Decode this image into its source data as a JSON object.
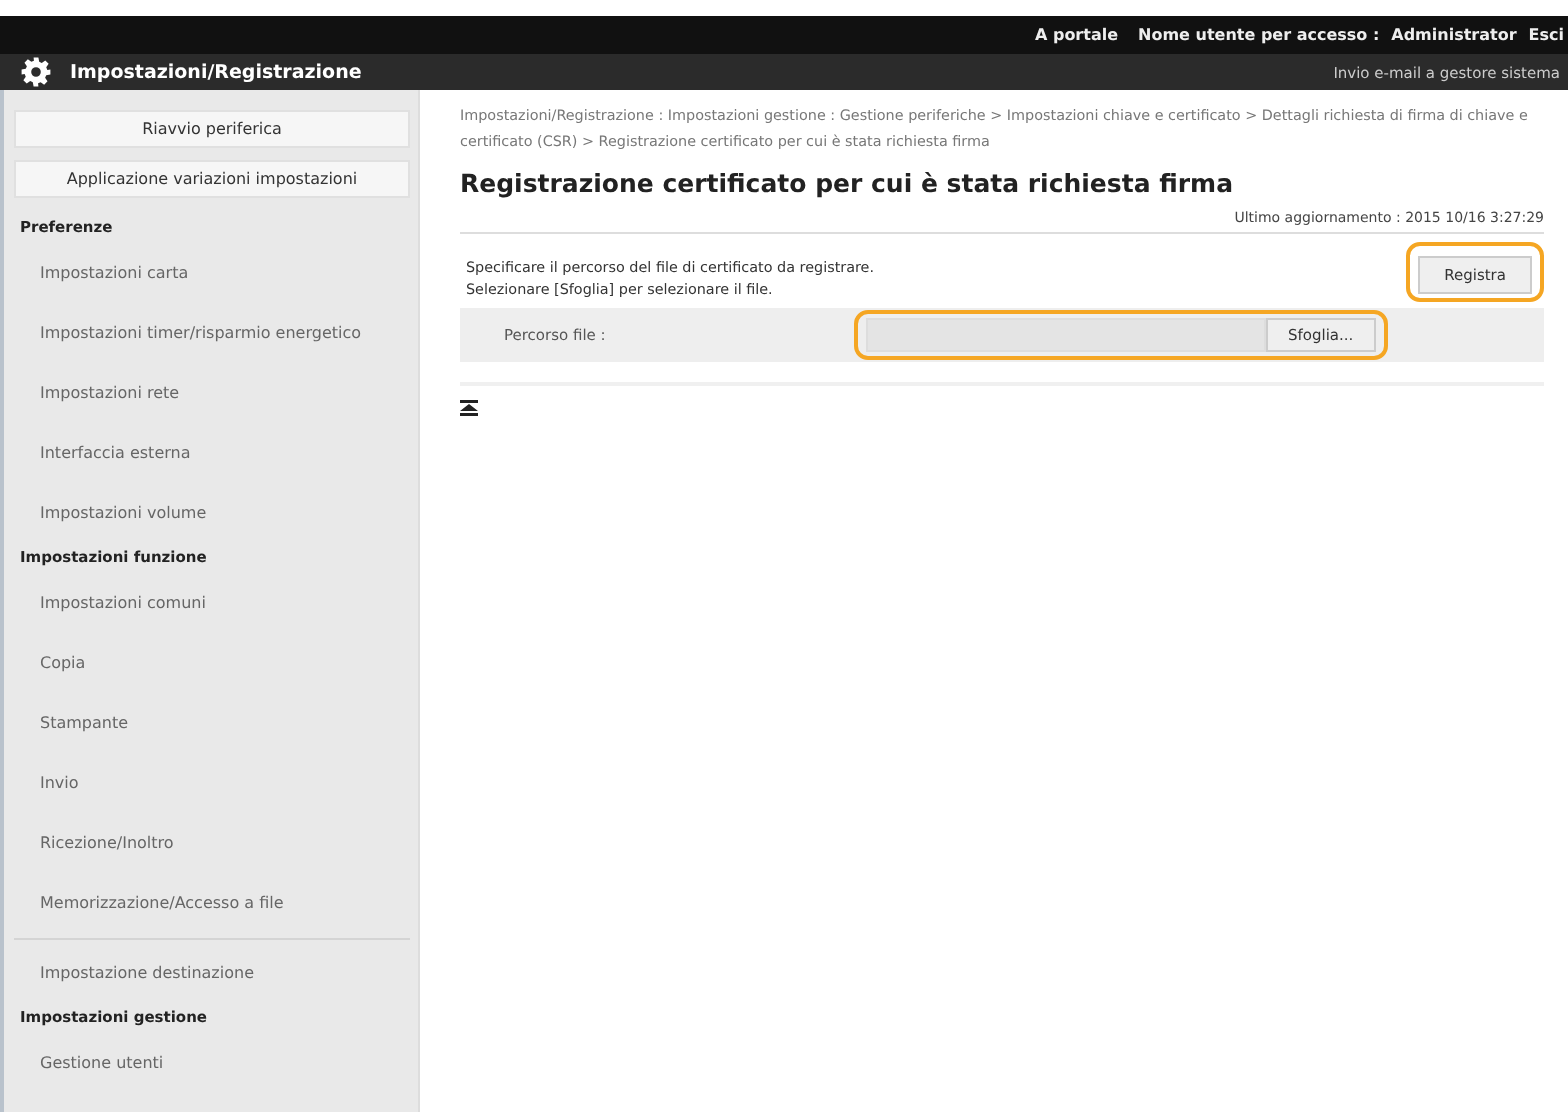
{
  "top_bar": {
    "links": [
      "A portale",
      "Nome utente per accesso :",
      "Administrator",
      "Esci"
    ]
  },
  "header": {
    "title": "Impostazioni/Registrazione",
    "mail_link": "Invio e-mail a gestore sistema"
  },
  "sidebar": {
    "buttons": [
      "Riavvio periferica",
      "Applicazione variazioni impostazioni"
    ],
    "sections": [
      {
        "heading": "Preferenze",
        "items": [
          "Impostazioni carta",
          "Impostazioni timer/risparmio energetico",
          "Impostazioni rete",
          "Interfaccia esterna",
          "Impostazioni volume"
        ]
      },
      {
        "heading": "Impostazioni funzione",
        "items": [
          "Impostazioni comuni",
          "Copia",
          "Stampante",
          "Invio",
          "Ricezione/Inoltro",
          "Memorizzazione/Accesso a file"
        ]
      },
      {
        "items": [
          "Impostazione destinazione"
        ]
      },
      {
        "heading": "Impostazioni gestione",
        "items": [
          "Gestione utenti"
        ]
      }
    ]
  },
  "breadcrumb": "Impostazioni/Registrazione : Impostazioni gestione : Gestione periferiche > Impostazioni chiave e certificato > Dettagli richiesta di firma di chiave e certificato (CSR) > Registrazione certificato per cui è stata richiesta firma",
  "page_title": "Registrazione certificato per cui è stata richiesta firma",
  "last_update": "Ultimo aggiornamento : 2015 10/16 3:27:29",
  "instructions": [
    "Specificare il percorso del file di certificato da registrare.",
    "Selezionare [Sfoglia] per selezionare il file."
  ],
  "register_button": {
    "label": "Registra",
    "highlighted": true
  },
  "file_path": {
    "label": "Percorso file :",
    "browse_button": "Sfoglia...",
    "highlighted": true
  }
}
